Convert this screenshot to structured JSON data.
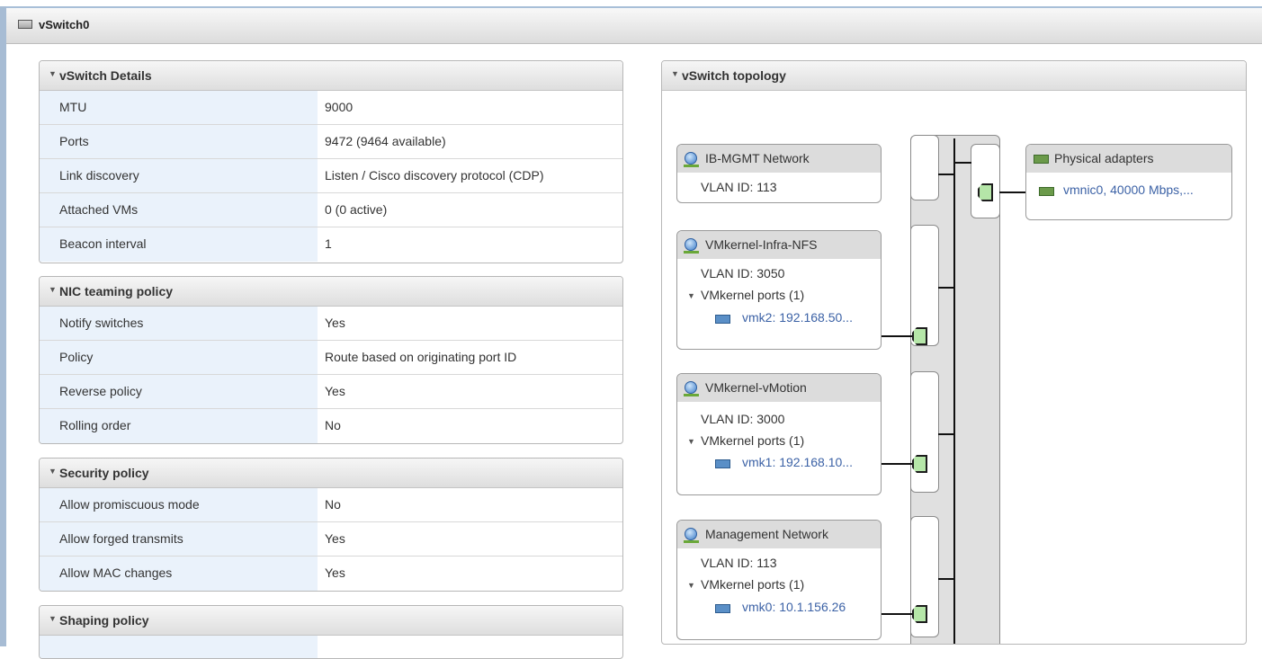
{
  "window": {
    "title": "vSwitch0"
  },
  "details": {
    "header": "vSwitch Details",
    "rows": [
      {
        "key": "MTU",
        "value": "9000"
      },
      {
        "key": "Ports",
        "value": "9472 (9464 available)"
      },
      {
        "key": "Link discovery",
        "value": "Listen / Cisco discovery protocol (CDP)"
      },
      {
        "key": "Attached VMs",
        "value": "0 (0 active)"
      },
      {
        "key": "Beacon interval",
        "value": "1"
      }
    ]
  },
  "nic_teaming": {
    "header": "NIC teaming policy",
    "rows": [
      {
        "key": "Notify switches",
        "value": "Yes"
      },
      {
        "key": "Policy",
        "value": "Route based on originating port ID"
      },
      {
        "key": "Reverse policy",
        "value": "Yes"
      },
      {
        "key": "Rolling order",
        "value": "No"
      }
    ]
  },
  "security": {
    "header": "Security policy",
    "rows": [
      {
        "key": "Allow promiscuous mode",
        "value": "No"
      },
      {
        "key": "Allow forged transmits",
        "value": "Yes"
      },
      {
        "key": "Allow MAC changes",
        "value": "Yes"
      }
    ]
  },
  "shaping": {
    "header": "Shaping policy"
  },
  "topology": {
    "header": "vSwitch topology",
    "portgroups": [
      {
        "name": "IB-MGMT Network",
        "vlan": "VLAN ID: 113"
      },
      {
        "name": "VMkernel-Infra-NFS",
        "vlan": "VLAN ID: 3050",
        "ports_label": "VMkernel ports (1)",
        "port": "vmk2: 192.168.50..."
      },
      {
        "name": "VMkernel-vMotion",
        "vlan": "VLAN ID: 3000",
        "ports_label": "VMkernel ports (1)",
        "port": "vmk1: 192.168.10..."
      },
      {
        "name": "Management Network",
        "vlan": "VLAN ID: 113",
        "ports_label": "VMkernel ports (1)",
        "port": "vmk0: 10.1.156.26"
      }
    ],
    "physical": {
      "title": "Physical adapters",
      "adapter": "vmnic0, 40000 Mbps,..."
    }
  }
}
